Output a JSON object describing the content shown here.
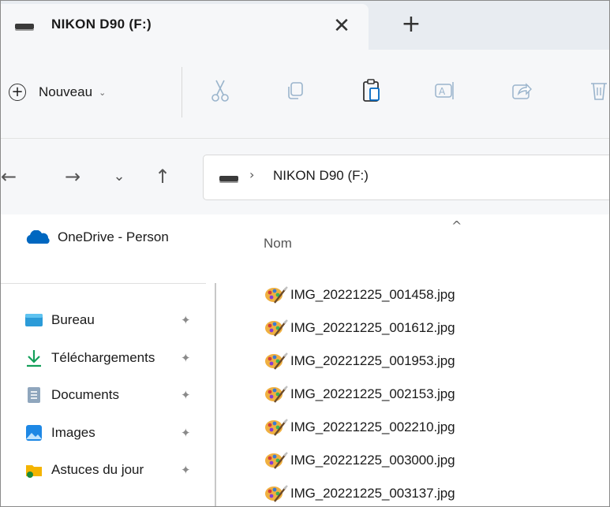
{
  "window": {
    "tab_title": "NIKON D90 (F:)",
    "close_glyph": "✕",
    "new_tab_glyph": "+"
  },
  "commandbar": {
    "new_label": "Nouveau",
    "new_chevron": "⌄",
    "icons": [
      "cut-icon",
      "copy-icon",
      "paste-icon",
      "rename-icon",
      "share-icon",
      "delete-icon"
    ]
  },
  "address": {
    "back": "←",
    "forward": "→",
    "recent": "⌄",
    "up": "↑",
    "separator": "›",
    "path": "NIKON D90 (F:)"
  },
  "navpane": {
    "onedrive_label": "OneDrive - Person",
    "quick_access": [
      {
        "label": "Bureau",
        "icon": "desktop-icon"
      },
      {
        "label": "Téléchargements",
        "icon": "download-icon"
      },
      {
        "label": "Documents",
        "icon": "documents-icon"
      },
      {
        "label": "Images",
        "icon": "pictures-icon"
      },
      {
        "label": "Astuces du jour",
        "icon": "folder-icon"
      }
    ],
    "pin_glyph": "📌"
  },
  "files": {
    "column_header": "Nom",
    "sort_caret": "^",
    "items": [
      "IMG_20221225_001458.jpg",
      "IMG_20221225_001612.jpg",
      "IMG_20221225_001953.jpg",
      "IMG_20221225_002153.jpg",
      "IMG_20221225_002210.jpg",
      "IMG_20221225_003000.jpg",
      "IMG_20221225_003137.jpg"
    ]
  },
  "colors": {
    "accent": "#0067c0",
    "chrome": "#f6f7f9",
    "tabbar": "#e8ecf1"
  }
}
